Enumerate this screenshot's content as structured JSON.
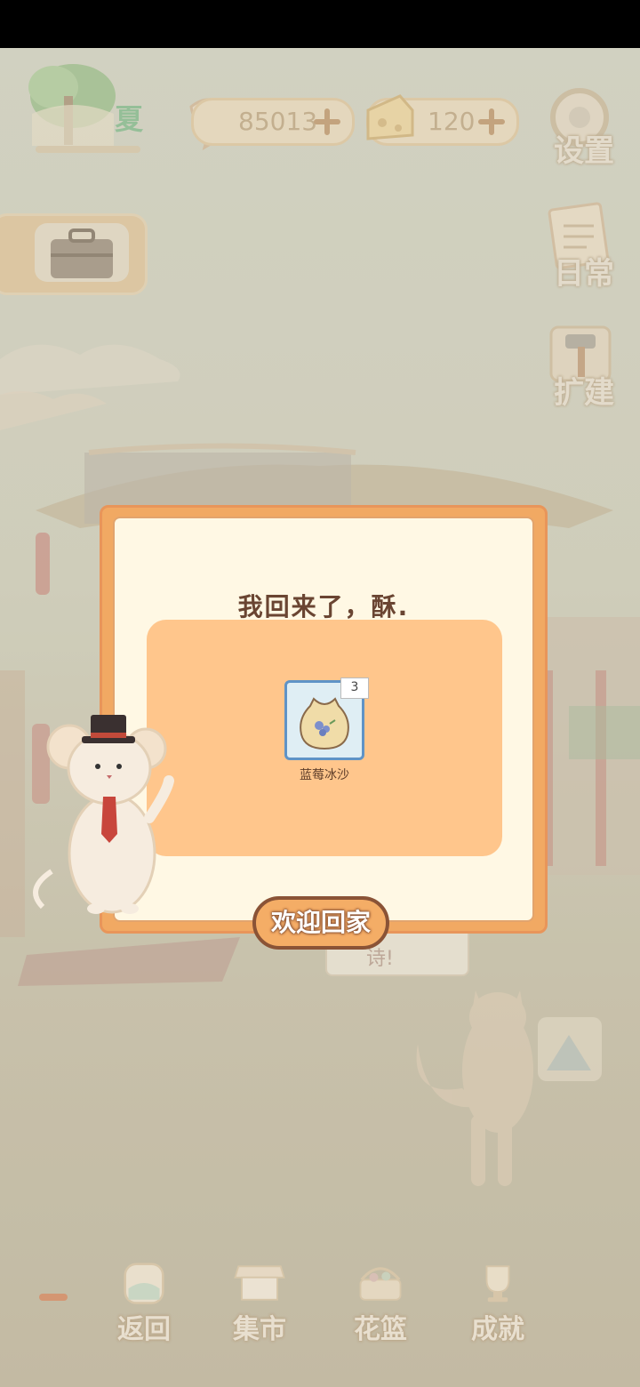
{
  "hud": {
    "season": "夏",
    "currency_fish": "85013",
    "currency_cheese": "120"
  },
  "side_menu": {
    "settings": "设置",
    "daily": "日常",
    "expand": "扩建"
  },
  "dialog": {
    "title": "我回来了，酥.",
    "reward": {
      "name": "蓝莓冰沙",
      "count": "3"
    },
    "confirm_label": "欢迎回家"
  },
  "background_speech": "诗!",
  "bottom_nav": {
    "back": "返回",
    "market": "集市",
    "basket": "花篮",
    "achievements": "成就"
  },
  "colors": {
    "dialog_frame": "#f1a963",
    "dialog_bg": "#fff8e4",
    "reward_panel": "#ffc68c",
    "item_card_border": "#5f93c6"
  }
}
